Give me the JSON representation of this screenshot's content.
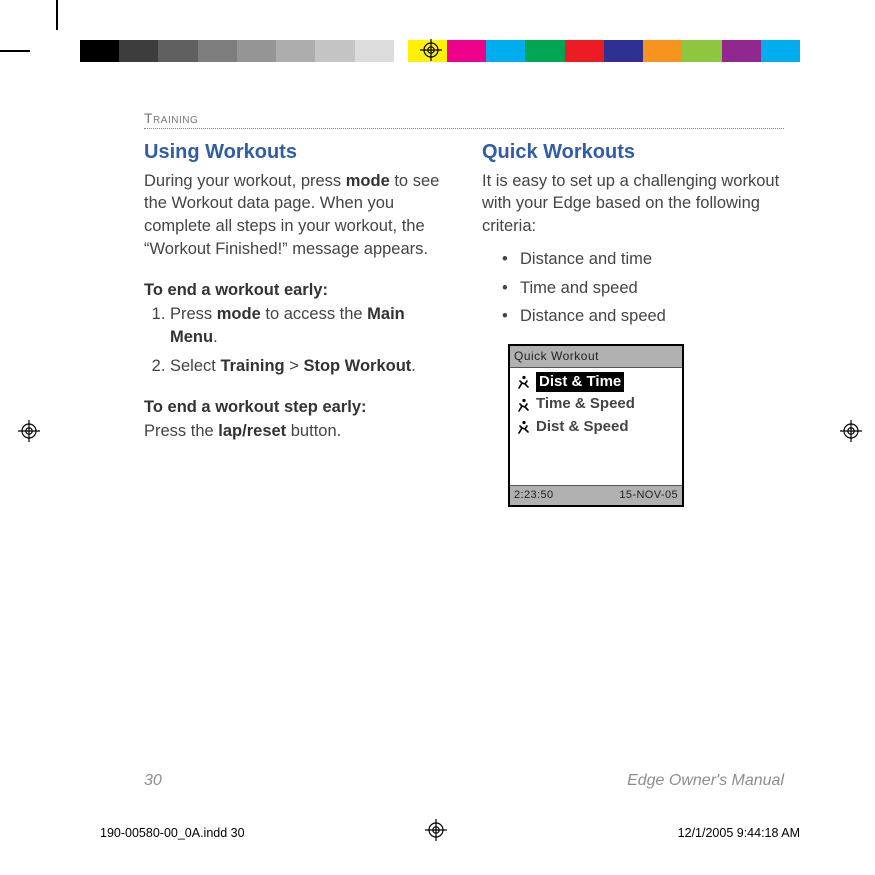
{
  "section_label": "Training",
  "left": {
    "heading": "Using Workouts",
    "para": "During your workout, press mode to see the Workout data page. When you complete all steps in your workout, the \"Workout Finished!\" message appears.",
    "bold_word_in_para": "mode",
    "sub1": "To end a workout early:",
    "step1_pre": "Press ",
    "step1_b1": "mode",
    "step1_mid": " to access the ",
    "step1_b2": "Main Menu",
    "step1_post": ".",
    "step2_pre": "Select ",
    "step2_b1": "Training",
    "step2_mid": " > ",
    "step2_b2": "Stop Workout",
    "step2_post": ".",
    "sub2": "To end a workout step early:",
    "sub2_line_pre": "Press the ",
    "sub2_line_b": "lap/reset",
    "sub2_line_post": " button."
  },
  "right": {
    "heading": "Quick Workouts",
    "para": "It is easy to set up a challenging workout with your Edge based on the following criteria:",
    "bullets": [
      "Distance and time",
      "Time and speed",
      "Distance and speed"
    ]
  },
  "device": {
    "title": "Quick Workout",
    "items": [
      "Dist & Time",
      "Time & Speed",
      "Dist & Speed"
    ],
    "selected_index": 0,
    "status_left": "2:23:50",
    "status_right": "15-NOV-05"
  },
  "footer": {
    "page_number": "30",
    "doc_title": "Edge Owner's Manual"
  },
  "imposition": {
    "file": "190-00580-00_0A.indd   30",
    "timestamp": "12/1/2005   9:44:18 AM"
  },
  "color_bar": [
    "#000000",
    "#3d3d3d",
    "#606060",
    "#7d7d7d",
    "#959595",
    "#adadad",
    "#c4c4c4",
    "#dcdcdc",
    "gap",
    "#fff200",
    "#ec008c",
    "#00aeef",
    "#00a651",
    "#ed1c24",
    "#2e3192",
    "#f7941d",
    "#8dc63f",
    "#92278f",
    "#00adef"
  ]
}
